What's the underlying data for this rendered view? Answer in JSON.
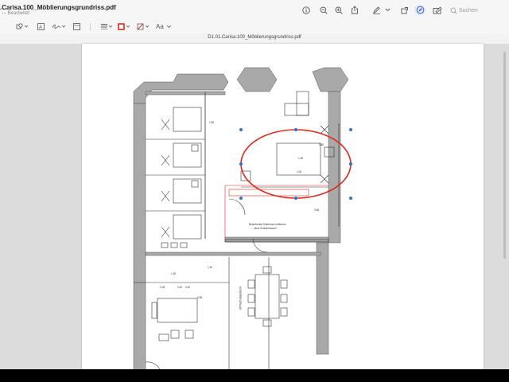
{
  "window": {
    "title": ".Carisa.100_Möblierungsgrundriss.pdf",
    "subtitle": "— Bearbeitet"
  },
  "toolbar": {
    "icons": [
      "info-icon",
      "zoom-out-icon",
      "zoom-in-icon",
      "share-icon",
      "markup-pen-icon",
      "chevron-down-icon",
      "rotate-icon",
      "markup-circle-icon",
      "signature-icon"
    ],
    "search_placeholder": "Suchen"
  },
  "markup_toolbar": {
    "text_style_label": "Aa"
  },
  "document": {
    "filename": "D1.01.Carisa.100_Möblierungsgrundriss.pdf"
  },
  "plan": {
    "labels": {
      "note1": "Bestehende Sideboard entfernen",
      "note2": "→ neue Schrankwand?",
      "room_label": "KONFERENZRAUM",
      "dim_180": "1.80",
      "dim_160": "1.60",
      "dim_140": "1.40",
      "dim_106": "1.06",
      "dim_040a": "0.40",
      "dim_040b": "0.40",
      "dim_080": "0.80",
      "dim_100": "1.00",
      "dim_150": "1.50",
      "dim_086": "0.86",
      "dim_085": "0.85"
    }
  },
  "colors": {
    "annotation": "#e0281e",
    "handle": "#2f6fdc",
    "wall": "#a9a9a9"
  }
}
